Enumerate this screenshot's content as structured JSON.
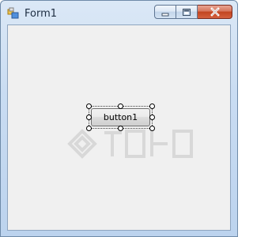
{
  "window": {
    "title": "Form1"
  },
  "designer": {
    "button_label": "button1"
  },
  "icons": {
    "app": "form-icon",
    "minimize": "minimize-icon",
    "maximize": "maximize-icon",
    "close": "close-icon"
  },
  "colors": {
    "client_bg": "#f0f0f0",
    "close_button": "#c2441f",
    "frame": "#bcd3ee"
  }
}
